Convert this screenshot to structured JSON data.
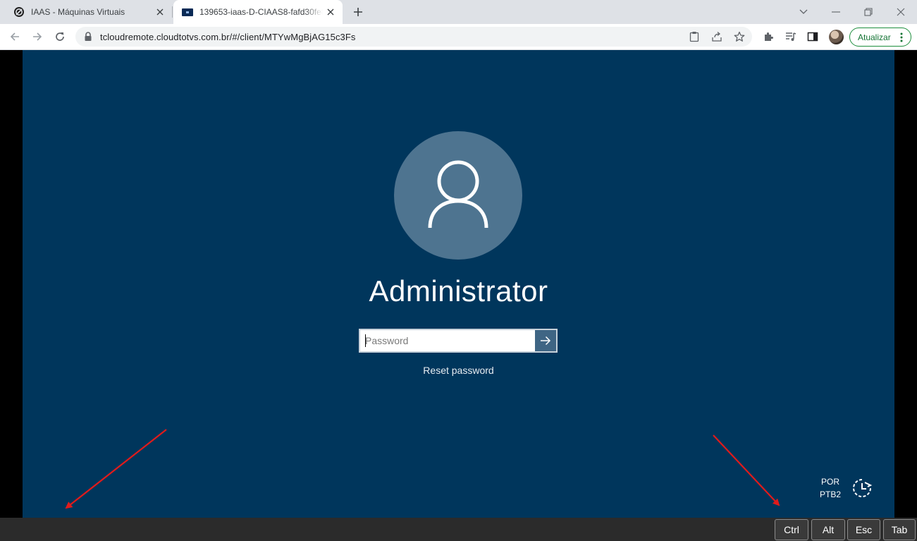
{
  "browser": {
    "tabs": [
      {
        "title": "IAAS - Máquinas Virtuais",
        "favicon": "totvs-logo-icon"
      },
      {
        "title": "139653-iaas-D-CIAAS8-fafd30fe8",
        "favicon": "remote-session-icon"
      }
    ],
    "url": "tcloudremote.cloudtotvs.com.br/#/client/MTYwMgBjAG15c3Fs",
    "update_label": "Atualizar"
  },
  "login": {
    "username": "Administrator",
    "password_placeholder": "Password",
    "password_value": "",
    "reset_label": "Reset password",
    "lang_line1": "POR",
    "lang_line2": "PTB2"
  },
  "keys": [
    "Ctrl",
    "Alt",
    "Esc",
    "Tab"
  ],
  "colors": {
    "remote_bg": "#00365c",
    "avatar_circle": "#4e7490",
    "submit_button": "#3f6584",
    "annotation_arrow": "#e01b1b",
    "update_border": "#1e8e3e"
  }
}
